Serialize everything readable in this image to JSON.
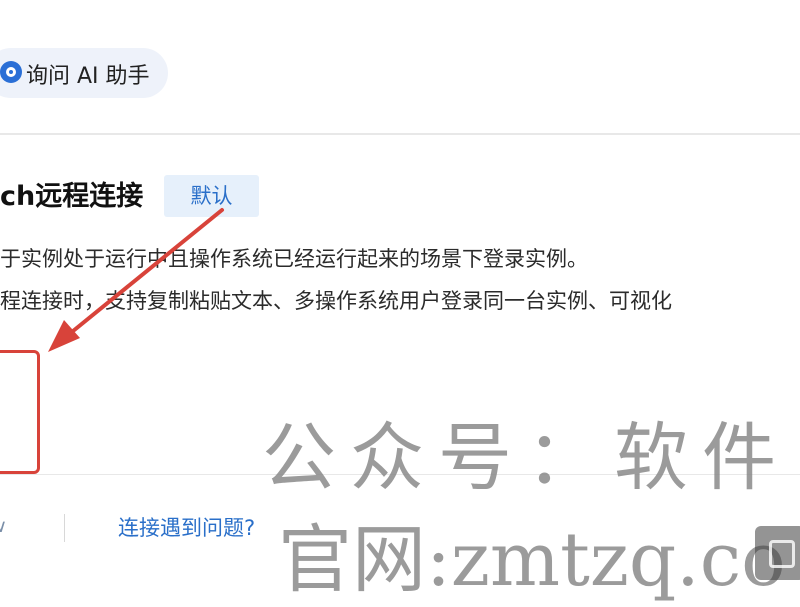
{
  "header": {
    "ai_assistant_label": "询问 AI 助手"
  },
  "connection": {
    "title": "ch远程连接",
    "badge": "默认",
    "description_line1": "于实例处于运行中且操作系统已经运行起来的场景下登录实例。",
    "description_line2": "程连接时，支持复制粘贴文本、多操作系统用户登录同一台实例、可视化"
  },
  "footer": {
    "help_link": "连接遇到问题?"
  },
  "watermark": {
    "line1": "公众号：软件",
    "line2": "官网:zmtzq.co"
  },
  "colors": {
    "accent": "#2a6fc9",
    "badge_bg": "#e6f0fb",
    "highlight_box": "#d8433a",
    "annotation_arrow": "#d8433a"
  },
  "icons": {
    "ai": "ai-assistant-icon",
    "chevron": "chevron-down-icon"
  }
}
